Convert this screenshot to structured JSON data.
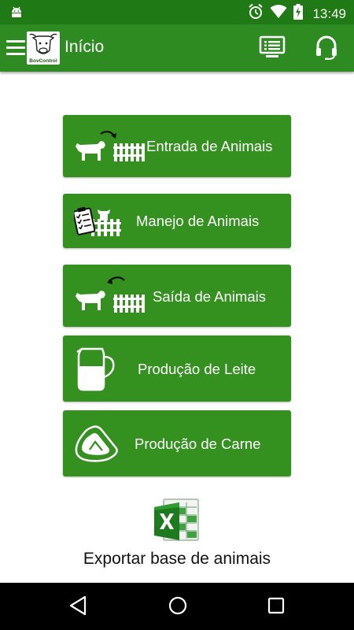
{
  "status_bar": {
    "time": "13:49",
    "icons": [
      "android-debug-icon",
      "alarm-icon",
      "wifi-icon",
      "battery-charging-icon"
    ]
  },
  "toolbar": {
    "logo_text": "BovControl",
    "title": "Início",
    "actions": [
      "list-screen-icon",
      "headset-support-icon"
    ]
  },
  "menu": {
    "items": [
      {
        "label": "Entrada de Animais",
        "icon": "cow-entering-fence-icon"
      },
      {
        "label": "Manejo de Animais",
        "icon": "clipboard-cow-icon"
      },
      {
        "label": "Saída de Animais",
        "icon": "cow-leaving-fence-icon"
      },
      {
        "label": "Produção de Leite",
        "icon": "milk-jug-icon"
      },
      {
        "label": "Produção de Carne",
        "icon": "meat-cut-icon"
      }
    ]
  },
  "export": {
    "label": "Exportar base de animais",
    "icon": "excel-icon"
  },
  "colors": {
    "status_bar": "#1f7a16",
    "toolbar": "#2e8b22",
    "card": "#34911f"
  }
}
